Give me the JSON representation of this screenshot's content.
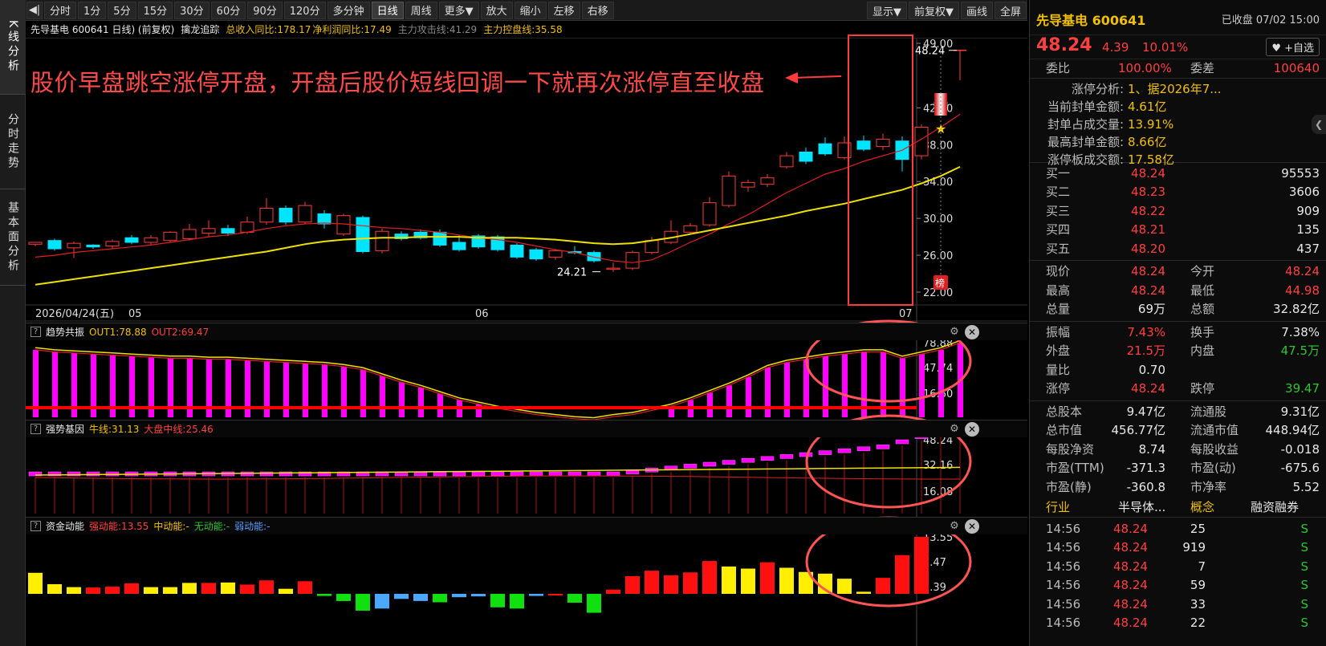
{
  "sidebar": {
    "tabs": [
      "K线分析",
      "分时走势",
      "基本面分析"
    ]
  },
  "toolbar": {
    "left_labels": [
      "分时",
      "1分",
      "5分",
      "15分",
      "30分",
      "60分",
      "90分",
      "120分",
      "多分钟",
      "日线",
      "周线",
      "更多▼",
      "放大",
      "缩小",
      "左移",
      "右移"
    ],
    "active_label": "日线",
    "right_labels": [
      "显示▼",
      "前复权▼",
      "画线",
      "全屏"
    ]
  },
  "info_bar": {
    "title": "先导基电 600641 日线) (前复权)",
    "indicator": "擒龙追踪",
    "item1": "总收入同比:178.17",
    "item2": "净利润同比:17.49",
    "item3": "主力攻击线:41.29",
    "item4": "主力控盘线:35.58"
  },
  "annotation": "股价早盘跳空涨停开盘，开盘后股价短线回调一下就再次涨停直至收盘",
  "main_chart": {
    "y_labels": [
      "49.00",
      "42.00",
      "38.00",
      "34.00",
      "30.00",
      "26.00",
      "22.00"
    ],
    "y_values": [
      49,
      42,
      38,
      34,
      30,
      26,
      22
    ],
    "x_labels": [
      {
        "text": "2026/04/24(五)",
        "index": 0
      },
      {
        "text": "05",
        "index": 5
      },
      {
        "text": "06",
        "index": 23
      },
      {
        "text": "07",
        "index": 45
      }
    ],
    "high_label": "48.24",
    "low_label": "24.21",
    "badge_label": "榜",
    "colors": {
      "up": "#ff3b3b",
      "down": "#00e5ff",
      "ma_short": "#e02020",
      "ma_long": "#f0e000"
    }
  },
  "chart_data": {
    "type": "candlestick",
    "candles": [
      [
        27.2,
        27.4,
        27.0,
        27.3
      ],
      [
        27.6,
        26.7,
        26.5,
        27.8
      ],
      [
        26.8,
        27.3,
        25.7,
        27.5
      ],
      [
        27.1,
        26.9,
        26.7,
        27.2
      ],
      [
        27.0,
        27.5,
        26.7,
        27.7
      ],
      [
        27.9,
        27.4,
        27.2,
        28.2
      ],
      [
        27.4,
        27.9,
        27.1,
        28.2
      ],
      [
        27.6,
        28.5,
        27.4,
        28.6
      ],
      [
        27.8,
        28.8,
        27.6,
        29.4
      ],
      [
        28.4,
        28.9,
        28.0,
        29.8
      ],
      [
        28.9,
        28.4,
        28.1,
        29.3
      ],
      [
        28.5,
        29.6,
        28.3,
        30.2
      ],
      [
        29.6,
        31.1,
        29.3,
        32.2
      ],
      [
        31.1,
        29.6,
        29.3,
        31.4
      ],
      [
        29.6,
        31.4,
        29.4,
        31.8
      ],
      [
        30.5,
        29.4,
        28.9,
        30.9
      ],
      [
        28.3,
        30.3,
        28.1,
        30.5
      ],
      [
        30.1,
        26.4,
        26.2,
        30.3
      ],
      [
        26.5,
        28.6,
        26.2,
        28.9
      ],
      [
        28.3,
        27.8,
        27.6,
        28.6
      ],
      [
        28.5,
        27.9,
        27.7,
        28.8
      ],
      [
        28.5,
        27.1,
        26.9,
        28.8
      ],
      [
        27.4,
        26.6,
        26.4,
        28.2
      ],
      [
        28.1,
        26.9,
        26.7,
        28.3
      ],
      [
        28.0,
        26.6,
        26.4,
        28.2
      ],
      [
        27.1,
        25.8,
        25.6,
        27.3
      ],
      [
        26.6,
        25.6,
        25.4,
        26.8
      ],
      [
        25.8,
        26.5,
        25.5,
        26.7
      ],
      [
        26.4,
        26.3,
        26.1,
        27.0
      ],
      [
        26.3,
        25.4,
        25.2,
        26.5
      ],
      [
        24.6,
        24.6,
        24.2,
        25.2
      ],
      [
        24.6,
        26.3,
        24.4,
        26.5
      ],
      [
        26.3,
        27.6,
        26.1,
        28.0
      ],
      [
        27.4,
        28.6,
        27.2,
        29.8
      ],
      [
        28.5,
        29.2,
        28.3,
        29.5
      ],
      [
        29.3,
        31.7,
        29.1,
        32.3
      ],
      [
        31.4,
        34.6,
        31.2,
        35.1
      ],
      [
        33.4,
        33.9,
        32.9,
        34.2
      ],
      [
        33.7,
        34.4,
        33.4,
        34.8
      ],
      [
        35.6,
        36.8,
        35.4,
        37.2
      ],
      [
        37.2,
        36.2,
        35.9,
        37.7
      ],
      [
        38.1,
        37.0,
        36.8,
        38.8
      ],
      [
        36.6,
        38.2,
        36.4,
        38.9
      ],
      [
        38.4,
        37.5,
        37.3,
        39.0
      ],
      [
        37.8,
        38.6,
        37.4,
        39.2
      ],
      [
        38.4,
        36.4,
        35.1,
        38.9
      ],
      [
        36.8,
        39.9,
        36.4,
        40.2
      ],
      [
        42.6,
        42.2,
        41.9,
        42.7
      ],
      [
        48.24,
        48.24,
        44.98,
        48.24
      ]
    ],
    "ma_short": [
      25.8,
      26.0,
      26.3,
      26.5,
      26.7,
      26.9,
      27.1,
      27.4,
      27.7,
      28.0,
      28.2,
      28.5,
      28.9,
      29.2,
      29.4,
      29.5,
      29.4,
      29.2,
      29.0,
      28.9,
      28.7,
      28.5,
      28.2,
      27.9,
      27.7,
      27.4,
      27.0,
      26.6,
      26.3,
      25.8,
      25.4,
      25.2,
      25.5,
      26.4,
      27.4,
      28.3,
      29.4,
      30.4,
      31.6,
      32.8,
      33.8,
      34.8,
      35.4,
      36.2,
      36.8,
      37.4,
      38.6,
      39.9,
      41.3
    ],
    "ma_long": [
      22.8,
      23.1,
      23.4,
      23.7,
      24.0,
      24.3,
      24.6,
      24.9,
      25.2,
      25.5,
      25.8,
      26.1,
      26.4,
      26.8,
      27.2,
      27.5,
      27.7,
      27.8,
      27.9,
      27.9,
      28.0,
      28.0,
      28.0,
      27.9,
      27.9,
      27.9,
      27.8,
      27.7,
      27.5,
      27.3,
      27.2,
      27.3,
      27.6,
      27.9,
      28.3,
      28.7,
      29.1,
      29.5,
      29.9,
      30.3,
      30.8,
      31.2,
      31.6,
      32.1,
      32.6,
      33.1,
      33.8,
      34.6,
      35.6
    ]
  },
  "pane1": {
    "title": "趋势共振",
    "out1": "OUT1:78.88",
    "out2": "OUT2:69.47",
    "y_labels": [
      "78.88",
      "47.74",
      "16.60"
    ],
    "bars": [
      72,
      70,
      69,
      68,
      67,
      66,
      65,
      64,
      64,
      63,
      63,
      62,
      61,
      60,
      59,
      58,
      56,
      53,
      47,
      41,
      36,
      30,
      24,
      20,
      16,
      13,
      10,
      8,
      6,
      5,
      8,
      10,
      14,
      18,
      24,
      31,
      38,
      46,
      55,
      60,
      63,
      66,
      68,
      70,
      70,
      64,
      68,
      72,
      78.88
    ]
  },
  "pane2": {
    "title": "强势基因",
    "bull": "牛线:31.13",
    "mid": "大盘中线:25.46",
    "y_labels": [
      "48.24",
      "32.16",
      "16.08"
    ]
  },
  "pane3": {
    "title": "资金动能",
    "strong": "强动能:13.55",
    "medium": "中动能:-",
    "none": "无动能:-",
    "weak": "弱动能:-",
    "y_labels": [
      "13.55",
      "7.47",
      "1.39"
    ],
    "bars": [
      [
        5,
        "y"
      ],
      [
        2.3,
        "y"
      ],
      [
        1.6,
        "y"
      ],
      [
        1.5,
        "r"
      ],
      [
        1.7,
        "r"
      ],
      [
        2.5,
        "r"
      ],
      [
        1.6,
        "y"
      ],
      [
        1.6,
        "y"
      ],
      [
        2.6,
        "y"
      ],
      [
        2.6,
        "r"
      ],
      [
        2.7,
        "y"
      ],
      [
        2.2,
        "r"
      ],
      [
        3.2,
        "r"
      ],
      [
        1.2,
        "y"
      ],
      [
        3.0,
        "r"
      ],
      [
        -0.5,
        "g"
      ],
      [
        -1.7,
        "g"
      ],
      [
        -4,
        "g"
      ],
      [
        -3.5,
        "b"
      ],
      [
        -1.2,
        "b"
      ],
      [
        -1.7,
        "b"
      ],
      [
        -2.0,
        "g"
      ],
      [
        -0.8,
        "b"
      ],
      [
        -0.6,
        "b"
      ],
      [
        -3.2,
        "g"
      ],
      [
        -3.5,
        "g"
      ],
      [
        -0.5,
        "b"
      ],
      [
        -0.4,
        "r"
      ],
      [
        -2.1,
        "g"
      ],
      [
        -4.5,
        "g"
      ],
      [
        1.0,
        "r"
      ],
      [
        4.2,
        "r"
      ],
      [
        5.5,
        "r"
      ],
      [
        4.4,
        "r"
      ],
      [
        5.1,
        "r"
      ],
      [
        7.8,
        "r"
      ],
      [
        6.5,
        "y"
      ],
      [
        6.0,
        "y"
      ],
      [
        7.5,
        "r"
      ],
      [
        6.2,
        "y"
      ],
      [
        5.2,
        "y"
      ],
      [
        4.8,
        "y"
      ],
      [
        3.6,
        "y"
      ],
      [
        0.5,
        "y"
      ],
      [
        3.8,
        "r"
      ],
      [
        9.2,
        "r"
      ],
      [
        13.55,
        "r"
      ]
    ]
  },
  "right_panel": {
    "name": "先导基电 600641",
    "status": "已收盘 07/02 15:00",
    "price": "48.24",
    "change": "4.39",
    "pct": "10.01%",
    "add_btn": "♥ +自选",
    "wb_label": "委比",
    "wb_val": "100.00%",
    "wc_label": "委差",
    "wc_val": "100640",
    "zt_lines": [
      [
        "涨停分析:",
        "1、据2026年7..."
      ],
      [
        "当前封单金额:",
        "4.61亿"
      ],
      [
        "封单占成交量:",
        "13.91%"
      ],
      [
        "最高封单金额:",
        "8.66亿"
      ],
      [
        "涨停板成交额:",
        "17.58亿"
      ]
    ],
    "bids": [
      [
        "买一",
        "48.24",
        "95553"
      ],
      [
        "买二",
        "48.23",
        "3606"
      ],
      [
        "买三",
        "48.22",
        "909"
      ],
      [
        "买四",
        "48.21",
        "135"
      ],
      [
        "买五",
        "48.20",
        "437"
      ]
    ],
    "quote1": [
      [
        "现价",
        "48.24",
        "今开",
        "48.24"
      ],
      [
        "最高",
        "48.24",
        "最低",
        "44.98"
      ],
      [
        "总量",
        "69万",
        "总额",
        "32.82亿"
      ]
    ],
    "quote2": [
      [
        "振幅",
        "7.43%",
        "换手",
        "7.38%"
      ],
      [
        "外盘",
        "21.5万",
        "内盘",
        "47.5万"
      ],
      [
        "量比",
        "0.70",
        "",
        ""
      ],
      [
        "涨停",
        "48.24",
        "跌停",
        "39.47"
      ]
    ],
    "fund": [
      [
        "总股本",
        "9.47亿",
        "流通股",
        "9.31亿"
      ],
      [
        "总市值",
        "456.77亿",
        "流通市值",
        "448.94亿"
      ],
      [
        "每股净资",
        "8.74",
        "每股收益",
        "-0.018"
      ],
      [
        "市盈(TTM)",
        "-371.3",
        "市盈(动)",
        "-675.6"
      ],
      [
        "市盈(静)",
        "-360.8",
        "市净率",
        "5.52"
      ]
    ],
    "tabs": [
      "行业",
      "半导体...",
      "概念",
      "融资融券"
    ],
    "ticks": [
      [
        "14:56",
        "48.24",
        "25",
        "S"
      ],
      [
        "14:56",
        "48.24",
        "919",
        "S"
      ],
      [
        "14:56",
        "48.24",
        "7",
        "S"
      ],
      [
        "14:56",
        "48.24",
        "59",
        "S"
      ],
      [
        "14:56",
        "48.24",
        "33",
        "S"
      ],
      [
        "14:56",
        "48.24",
        "22",
        "S"
      ]
    ]
  }
}
